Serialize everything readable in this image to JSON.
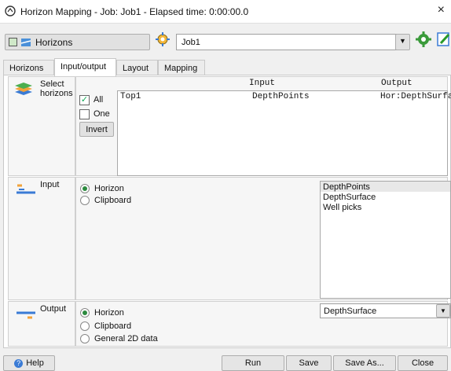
{
  "window": {
    "title": "Horizon Mapping - Job: Job1 - Elapsed time: 0:00:00.0",
    "close": "×"
  },
  "toolbar": {
    "module": "Horizons",
    "job": "Job1"
  },
  "tabs": [
    "Horizons",
    "Input/output",
    "Layout",
    "Mapping"
  ],
  "select": {
    "label": "Select horizons",
    "all": "All",
    "one": "One",
    "invert": "Invert",
    "headers": {
      "input": "Input",
      "output": "Output"
    },
    "rows": [
      {
        "name": "Top1",
        "input": "DepthPoints",
        "output": "Hor:DepthSurfa"
      }
    ]
  },
  "input": {
    "label": "Input",
    "options": [
      "Horizon",
      "Clipboard"
    ],
    "list": [
      "DepthPoints",
      "DepthSurface",
      "Well picks"
    ]
  },
  "output": {
    "label": "Output",
    "options": [
      "Horizon",
      "Clipboard",
      "General 2D data"
    ],
    "selected": "DepthSurface"
  },
  "buttons": {
    "help": "Help",
    "run": "Run",
    "save": "Save",
    "save_as": "Save As...",
    "close": "Close"
  },
  "colors": {
    "accent": "#2b8a3e",
    "selection": "#e8e8e8"
  }
}
